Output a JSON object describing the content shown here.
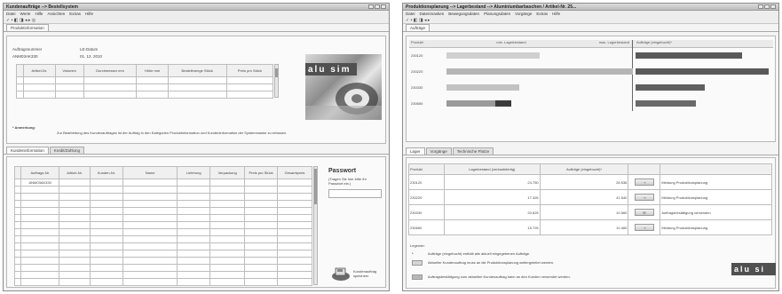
{
  "left_window": {
    "title": "Kundenaufträge --> Bestellsystem",
    "menu": [
      "Datei",
      "Werte",
      "Hilfe",
      "Ansichten",
      "Extras",
      "Hilfe"
    ],
    "toolbar": "✓ ▪ ◧ ◨ ◂ ▸ ◎",
    "tabs_top": [
      "Produktinformation"
    ],
    "order_label": "Auftragsnummer",
    "order_value": "ANM03AK330",
    "date_label": "LE-Datum",
    "date_value": "01. 12. 2010",
    "product_table": {
      "headers": [
        "Artikel-Nr.",
        "Volumen",
        "Durchmesser mm",
        "Höhe mm",
        "Bestellmenge Stück",
        "Preis pro Stück"
      ]
    },
    "note_title": "* Anmerkung:",
    "note_text": "Zur Bearbeitung des Kundenauftrages ist der Auftrag in den Kategorien Produktinformation und Kundeninformation der Systemmaske zu erfassen.",
    "tabs_bottom": [
      "Kundeninformation",
      "Kredit/Zahlung"
    ],
    "order_table": {
      "headers": [
        "Auftrags-Nr.",
        "Artikel-Nr.",
        "Kunden-Nr.",
        "Name",
        "Lieferung",
        "Verpackung",
        "Preis pro Stück",
        "Gesamtpreis"
      ],
      "rows": [
        [
          "ANM03AK330",
          "",
          "",
          "",
          "",
          "",
          "",
          ""
        ]
      ]
    },
    "password_title": "Passwort",
    "password_hint": "(Tragen Sie hier bitte Ihr Passwort ein.)",
    "save_label": "Kundenauftrag speichern",
    "logo_text": "alu sim"
  },
  "right_window": {
    "title": "Produktionsplanung --> Lagerbestand --> Aluminiumbarbaschen / Artikel-Nr. 25...",
    "menu": [
      "Datei",
      "Datenmasken",
      "Bewegungsdaten",
      "Planungsdaten",
      "Vorgänge",
      "Extras",
      "Hilfe"
    ],
    "toolbar": "✓ ▪ ◧ ◨ ◂ ▸",
    "tabs_top": [
      "Aufträge"
    ],
    "chart_headers": [
      "Produkt",
      "min. Lagerbestand",
      "max. Lagerbestand",
      "Aufträge (eingebucht)*"
    ],
    "products": [
      "230120",
      "230220",
      "230330",
      "230650"
    ],
    "tabs_bottom": [
      "Lager",
      "Vorgänge",
      "Technische Platze"
    ],
    "stock_table": {
      "headers": [
        "Produkt",
        "Lagerbestand (verkaufsfertig)",
        "Aufträge (eingebucht)*",
        "",
        ""
      ],
      "rows": [
        [
          "230120",
          "24.750",
          "28.536",
          "Meldung Produktionsplanung"
        ],
        [
          "230220",
          "17.325",
          "41.540",
          "Meldung Produktionsplanung"
        ],
        [
          "230330",
          "20.625",
          "10.560",
          "Auftragsbestätigung versenden"
        ],
        [
          "230650",
          "15.725",
          "10.460",
          "Meldung Produktionsplanung"
        ]
      ]
    },
    "legend_title": "Legende:",
    "legend_items": [
      "Aufträge (eingebucht) enthält alle aktuell eingegebenen Aufträge.",
      "Aktueller Kundenauftrag muss an die Produktionsplanung weitergeleitet werden.",
      "Auftragsbestätigung zum aktuellen Kundenauftrag kann an den Kunden versendet werden."
    ],
    "logo_text": "alu si"
  }
}
